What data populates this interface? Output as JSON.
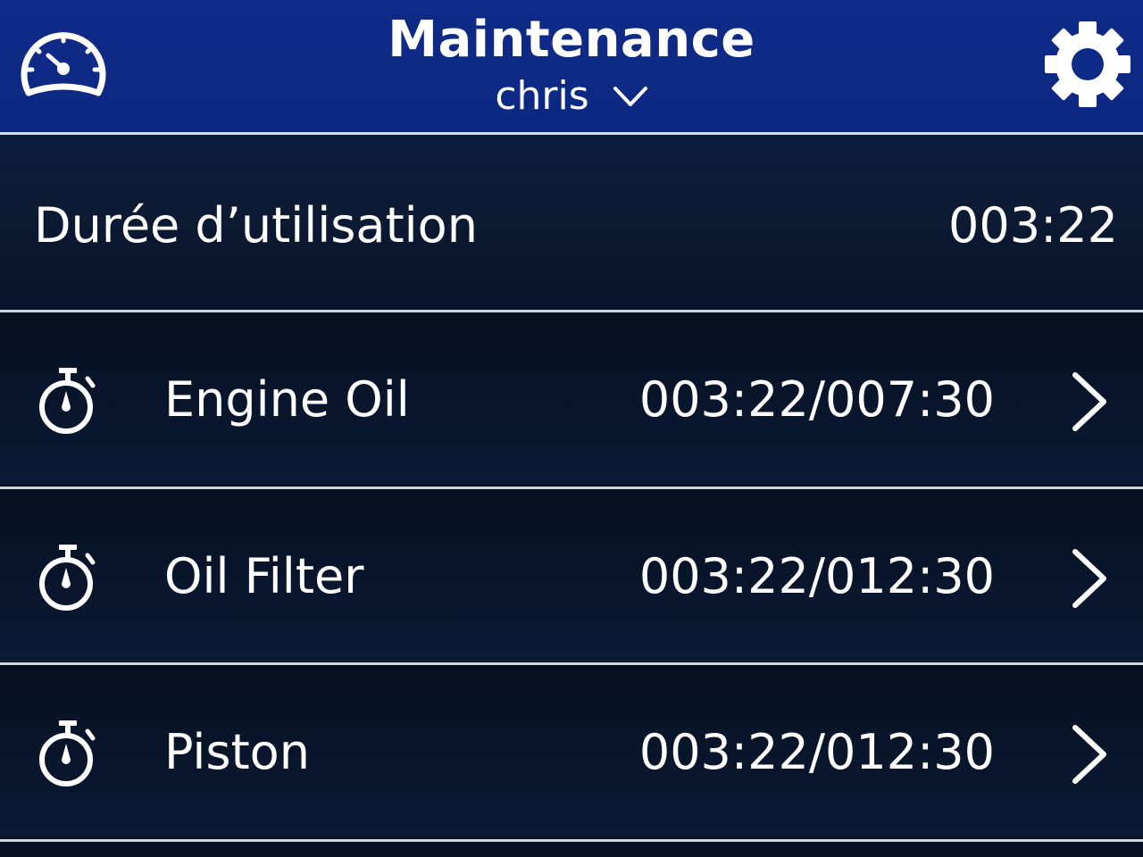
{
  "header": {
    "title": "Maintenance",
    "user": "chris",
    "left_icon": "speedometer-icon",
    "right_icon": "gear-icon",
    "background_color": "#0d2a86"
  },
  "usage": {
    "label": "Durée d’utilisation",
    "value": "003:22"
  },
  "items": [
    {
      "name": "Engine Oil",
      "value": "003:22/007:30",
      "icon": "stopwatch-icon"
    },
    {
      "name": "Oil Filter",
      "value": "003:22/012:30",
      "icon": "stopwatch-icon"
    },
    {
      "name": "Piston",
      "value": "003:22/012:30",
      "icon": "stopwatch-icon"
    }
  ]
}
